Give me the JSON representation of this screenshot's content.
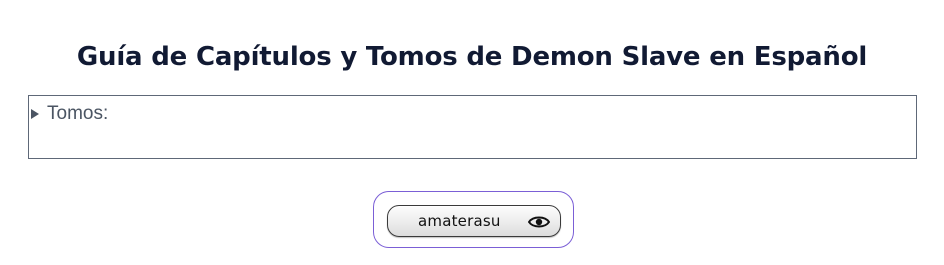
{
  "page": {
    "title": "Guía de Capítulos y Tomos de Demon Slave en Español"
  },
  "volumes_section": {
    "summary_label": "Tomos:",
    "expanded": false
  },
  "user_badge": {
    "username": "amaterasu",
    "icon": "eye-icon",
    "accent_color": "#7b5fd6"
  }
}
